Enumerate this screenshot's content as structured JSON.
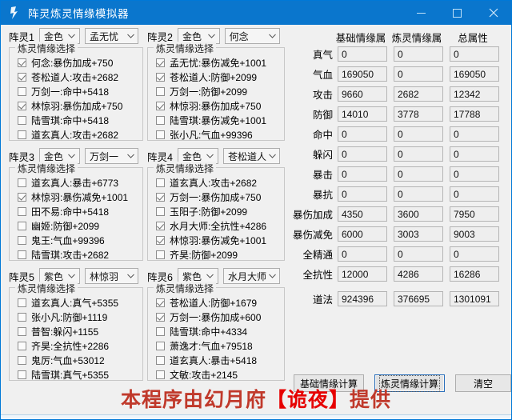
{
  "window": {
    "title": "阵灵炼灵情缘模拟器",
    "icon": "app-icon",
    "controls": {
      "minimize": "–",
      "maximize": "▢",
      "close": "✕"
    }
  },
  "arrays": [
    {
      "label": "阵灵1",
      "color": "金色",
      "spirit": "孟无忧",
      "group_title": "炼灵情缘选择",
      "options": [
        {
          "text": "何念:暴伤加成+750",
          "checked": true
        },
        {
          "text": "苍松道人:攻击+2682",
          "checked": true
        },
        {
          "text": "万剑一:命中+5418",
          "checked": false
        },
        {
          "text": "林惊羽:暴伤加成+750",
          "checked": true
        },
        {
          "text": "陆雪琪:命中+5418",
          "checked": false
        },
        {
          "text": "道玄真人:攻击+2682",
          "checked": false
        }
      ]
    },
    {
      "label": "阵灵2",
      "color": "金色",
      "spirit": "何念",
      "group_title": "炼灵情缘选择",
      "options": [
        {
          "text": "孟无忧:暴伤减免+1001",
          "checked": true
        },
        {
          "text": "苍松道人:防御+2099",
          "checked": true
        },
        {
          "text": "万剑一:防御+2099",
          "checked": false
        },
        {
          "text": "林惊羽:暴伤加成+750",
          "checked": true
        },
        {
          "text": "陆雪琪:暴伤减免+1001",
          "checked": false
        },
        {
          "text": "张小凡:气血+99396",
          "checked": false
        }
      ]
    },
    {
      "label": "阵灵3",
      "color": "金色",
      "spirit": "万剑一",
      "group_title": "炼灵情缘选择",
      "options": [
        {
          "text": "道玄真人:暴击+6773",
          "checked": false
        },
        {
          "text": "林惊羽:暴伤减免+1001",
          "checked": true
        },
        {
          "text": "田不易:命中+5418",
          "checked": false
        },
        {
          "text": "幽姬:防御+2099",
          "checked": false
        },
        {
          "text": "鬼王:气血+99396",
          "checked": false
        },
        {
          "text": "陆雪琪:攻击+2682",
          "checked": false
        }
      ]
    },
    {
      "label": "阵灵4",
      "color": "金色",
      "spirit": "苍松道人",
      "group_title": "炼灵情缘选择",
      "options": [
        {
          "text": "道玄真人:攻击+2682",
          "checked": false
        },
        {
          "text": "万剑一:暴伤加成+750",
          "checked": true
        },
        {
          "text": "玉阳子:防御+2099",
          "checked": false
        },
        {
          "text": "水月大师:全抗性+4286",
          "checked": true
        },
        {
          "text": "林惊羽:暴伤减免+1001",
          "checked": true
        },
        {
          "text": "齐昊:防御+2099",
          "checked": false
        }
      ]
    },
    {
      "label": "阵灵5",
      "color": "紫色",
      "spirit": "林惊羽",
      "group_title": "炼灵情缘选择",
      "options": [
        {
          "text": "道玄真人:真气+5355",
          "checked": false
        },
        {
          "text": "张小凡:防御+1119",
          "checked": false
        },
        {
          "text": "普智:躲闪+1155",
          "checked": false
        },
        {
          "text": "齐昊:全抗性+2286",
          "checked": false
        },
        {
          "text": "鬼厉:气血+53012",
          "checked": false
        },
        {
          "text": "陆雪琪:真气+5355",
          "checked": false
        }
      ]
    },
    {
      "label": "阵灵6",
      "color": "紫色",
      "spirit": "水月大师",
      "group_title": "炼灵情缘选择",
      "options": [
        {
          "text": "苍松道人:防御+1679",
          "checked": true
        },
        {
          "text": "万剑一:暴伤加成+600",
          "checked": true
        },
        {
          "text": "陆雪琪:命中+4334",
          "checked": false
        },
        {
          "text": "萧逸才:气血+79518",
          "checked": false
        },
        {
          "text": "道玄真人:暴击+5418",
          "checked": false
        },
        {
          "text": "文敏:攻击+2145",
          "checked": false
        }
      ]
    }
  ],
  "attributes": {
    "headers": [
      "基础情缘属性",
      "炼灵情缘属性",
      "总属性"
    ],
    "rows": [
      {
        "name": "真气",
        "base": "0",
        "refine": "0",
        "total": "0"
      },
      {
        "name": "气血",
        "base": "169050",
        "refine": "0",
        "total": "169050"
      },
      {
        "name": "攻击",
        "base": "9660",
        "refine": "2682",
        "total": "12342"
      },
      {
        "name": "防御",
        "base": "14010",
        "refine": "3778",
        "total": "17788"
      },
      {
        "name": "命中",
        "base": "0",
        "refine": "0",
        "total": "0"
      },
      {
        "name": "躲闪",
        "base": "0",
        "refine": "0",
        "total": "0"
      },
      {
        "name": "暴击",
        "base": "0",
        "refine": "0",
        "total": "0"
      },
      {
        "name": "暴抗",
        "base": "0",
        "refine": "0",
        "total": "0"
      },
      {
        "name": "暴伤加成",
        "base": "4350",
        "refine": "3600",
        "total": "7950"
      },
      {
        "name": "暴伤减免",
        "base": "6000",
        "refine": "3003",
        "total": "9003"
      },
      {
        "name": "全精通",
        "base": "0",
        "refine": "0",
        "total": "0"
      },
      {
        "name": "全抗性",
        "base": "12000",
        "refine": "4286",
        "total": "16286"
      },
      {
        "name": "道法",
        "base": "924396",
        "refine": "376695",
        "total": "1301091"
      }
    ]
  },
  "buttons": {
    "base_calc": "基础情缘计算",
    "refine_calc": "炼灵情缘计算",
    "clear": "清空"
  },
  "footer": {
    "prefix": "本程序由幻月府",
    "bracket_open": "【",
    "highlight": "诡夜",
    "bracket_close": "】",
    "suffix": "提供"
  },
  "colors": {
    "titlebar": "#0a76cd",
    "footer_text": "#c0392b",
    "focus_border": "#2a6fbb"
  }
}
